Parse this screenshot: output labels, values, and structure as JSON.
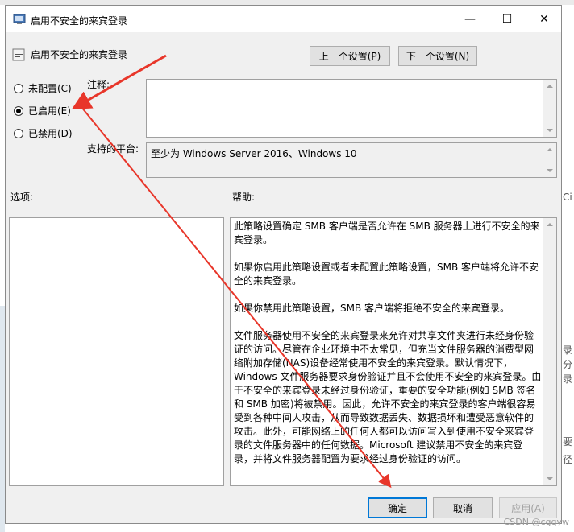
{
  "window": {
    "title": "启用不安全的来宾登录",
    "minimize": "—",
    "maximize": "☐",
    "close": "✕"
  },
  "policy": {
    "title": "启用不安全的来宾登录",
    "prev_button": "上一个设置(P)",
    "next_button": "下一个设置(N)"
  },
  "options": {
    "not_configured": "未配置(C)",
    "enabled": "已启用(E)",
    "disabled": "已禁用(D)",
    "selected": "enabled"
  },
  "labels": {
    "comment": "注释:",
    "supported": "支持的平台:",
    "options": "选项:",
    "help": "帮助:"
  },
  "supported_value": "至少为 Windows Server 2016、Windows 10",
  "help_paragraphs": [
    "此策略设置确定 SMB 客户端是否允许在 SMB 服务器上进行不安全的来宾登录。",
    "如果你启用此策略设置或者未配置此策略设置，SMB 客户端将允许不安全的来宾登录。",
    "如果你禁用此策略设置，SMB 客户端将拒绝不安全的来宾登录。",
    "文件服务器使用不安全的来宾登录来允许对共享文件夹进行未经身份验证的访问。尽管在企业环境中不太常见，但充当文件服务器的消费型网络附加存储(NAS)设备经常使用不安全的来宾登录。默认情况下，Windows 文件服务器要求身份验证并且不会使用不安全的来宾登录。由于不安全的来宾登录未经过身份验证，重要的安全功能(例如 SMB 签名和 SMB 加密)将被禁用。因此，允许不安全的来宾登录的客户端很容易受到各种中间人攻击，从而导致数据丢失、数据损坏和遭受恶意软件的攻击。此外，可能网络上的任何人都可以访问写入到使用不安全来宾登录的文件服务器中的任何数据。Microsoft 建议禁用不安全的来宾登录，并将文件服务器配置为要求经过身份验证的访问。"
  ],
  "buttons": {
    "ok": "确定",
    "cancel": "取消",
    "apply": "应用(A)"
  },
  "background": {
    "right_chars": [
      "Ci",
      "录",
      "分",
      "录",
      "要",
      "径"
    ]
  },
  "watermark": "CSDN @cgqyw",
  "colors": {
    "accent": "#0078d7",
    "annotation_arrow": "#e8362a"
  }
}
